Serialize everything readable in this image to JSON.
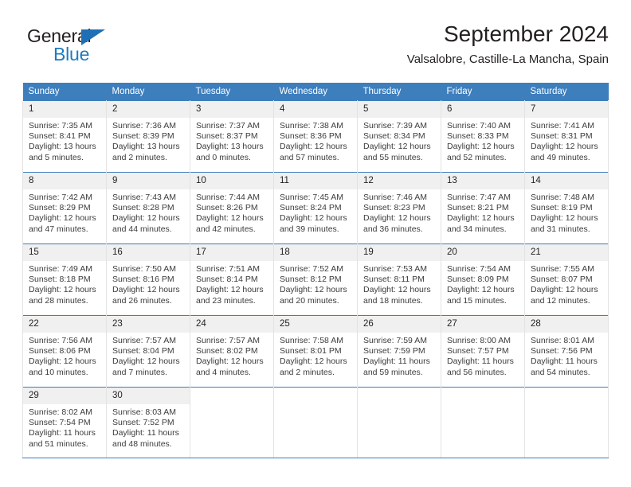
{
  "brand": {
    "name_part1": "General",
    "name_part2": "Blue",
    "triangle_color": "#1f6fb6",
    "blue_color": "#1f7ac0"
  },
  "header": {
    "title": "September 2024",
    "subtitle": "Valsalobre, Castille-La Mancha, Spain"
  },
  "colors": {
    "header_band": "#3d7ebd",
    "daynum_band": "#f0f0f0",
    "cell_border": "#e3e3e3",
    "text": "#231f20"
  },
  "weekdays": [
    "Sunday",
    "Monday",
    "Tuesday",
    "Wednesday",
    "Thursday",
    "Friday",
    "Saturday"
  ],
  "weeks": [
    [
      {
        "day": "1",
        "sunrise": "Sunrise: 7:35 AM",
        "sunset": "Sunset: 8:41 PM",
        "daylight": "Daylight: 13 hours and 5 minutes."
      },
      {
        "day": "2",
        "sunrise": "Sunrise: 7:36 AM",
        "sunset": "Sunset: 8:39 PM",
        "daylight": "Daylight: 13 hours and 2 minutes."
      },
      {
        "day": "3",
        "sunrise": "Sunrise: 7:37 AM",
        "sunset": "Sunset: 8:37 PM",
        "daylight": "Daylight: 13 hours and 0 minutes."
      },
      {
        "day": "4",
        "sunrise": "Sunrise: 7:38 AM",
        "sunset": "Sunset: 8:36 PM",
        "daylight": "Daylight: 12 hours and 57 minutes."
      },
      {
        "day": "5",
        "sunrise": "Sunrise: 7:39 AM",
        "sunset": "Sunset: 8:34 PM",
        "daylight": "Daylight: 12 hours and 55 minutes."
      },
      {
        "day": "6",
        "sunrise": "Sunrise: 7:40 AM",
        "sunset": "Sunset: 8:33 PM",
        "daylight": "Daylight: 12 hours and 52 minutes."
      },
      {
        "day": "7",
        "sunrise": "Sunrise: 7:41 AM",
        "sunset": "Sunset: 8:31 PM",
        "daylight": "Daylight: 12 hours and 49 minutes."
      }
    ],
    [
      {
        "day": "8",
        "sunrise": "Sunrise: 7:42 AM",
        "sunset": "Sunset: 8:29 PM",
        "daylight": "Daylight: 12 hours and 47 minutes."
      },
      {
        "day": "9",
        "sunrise": "Sunrise: 7:43 AM",
        "sunset": "Sunset: 8:28 PM",
        "daylight": "Daylight: 12 hours and 44 minutes."
      },
      {
        "day": "10",
        "sunrise": "Sunrise: 7:44 AM",
        "sunset": "Sunset: 8:26 PM",
        "daylight": "Daylight: 12 hours and 42 minutes."
      },
      {
        "day": "11",
        "sunrise": "Sunrise: 7:45 AM",
        "sunset": "Sunset: 8:24 PM",
        "daylight": "Daylight: 12 hours and 39 minutes."
      },
      {
        "day": "12",
        "sunrise": "Sunrise: 7:46 AM",
        "sunset": "Sunset: 8:23 PM",
        "daylight": "Daylight: 12 hours and 36 minutes."
      },
      {
        "day": "13",
        "sunrise": "Sunrise: 7:47 AM",
        "sunset": "Sunset: 8:21 PM",
        "daylight": "Daylight: 12 hours and 34 minutes."
      },
      {
        "day": "14",
        "sunrise": "Sunrise: 7:48 AM",
        "sunset": "Sunset: 8:19 PM",
        "daylight": "Daylight: 12 hours and 31 minutes."
      }
    ],
    [
      {
        "day": "15",
        "sunrise": "Sunrise: 7:49 AM",
        "sunset": "Sunset: 8:18 PM",
        "daylight": "Daylight: 12 hours and 28 minutes."
      },
      {
        "day": "16",
        "sunrise": "Sunrise: 7:50 AM",
        "sunset": "Sunset: 8:16 PM",
        "daylight": "Daylight: 12 hours and 26 minutes."
      },
      {
        "day": "17",
        "sunrise": "Sunrise: 7:51 AM",
        "sunset": "Sunset: 8:14 PM",
        "daylight": "Daylight: 12 hours and 23 minutes."
      },
      {
        "day": "18",
        "sunrise": "Sunrise: 7:52 AM",
        "sunset": "Sunset: 8:12 PM",
        "daylight": "Daylight: 12 hours and 20 minutes."
      },
      {
        "day": "19",
        "sunrise": "Sunrise: 7:53 AM",
        "sunset": "Sunset: 8:11 PM",
        "daylight": "Daylight: 12 hours and 18 minutes."
      },
      {
        "day": "20",
        "sunrise": "Sunrise: 7:54 AM",
        "sunset": "Sunset: 8:09 PM",
        "daylight": "Daylight: 12 hours and 15 minutes."
      },
      {
        "day": "21",
        "sunrise": "Sunrise: 7:55 AM",
        "sunset": "Sunset: 8:07 PM",
        "daylight": "Daylight: 12 hours and 12 minutes."
      }
    ],
    [
      {
        "day": "22",
        "sunrise": "Sunrise: 7:56 AM",
        "sunset": "Sunset: 8:06 PM",
        "daylight": "Daylight: 12 hours and 10 minutes."
      },
      {
        "day": "23",
        "sunrise": "Sunrise: 7:57 AM",
        "sunset": "Sunset: 8:04 PM",
        "daylight": "Daylight: 12 hours and 7 minutes."
      },
      {
        "day": "24",
        "sunrise": "Sunrise: 7:57 AM",
        "sunset": "Sunset: 8:02 PM",
        "daylight": "Daylight: 12 hours and 4 minutes."
      },
      {
        "day": "25",
        "sunrise": "Sunrise: 7:58 AM",
        "sunset": "Sunset: 8:01 PM",
        "daylight": "Daylight: 12 hours and 2 minutes."
      },
      {
        "day": "26",
        "sunrise": "Sunrise: 7:59 AM",
        "sunset": "Sunset: 7:59 PM",
        "daylight": "Daylight: 11 hours and 59 minutes."
      },
      {
        "day": "27",
        "sunrise": "Sunrise: 8:00 AM",
        "sunset": "Sunset: 7:57 PM",
        "daylight": "Daylight: 11 hours and 56 minutes."
      },
      {
        "day": "28",
        "sunrise": "Sunrise: 8:01 AM",
        "sunset": "Sunset: 7:56 PM",
        "daylight": "Daylight: 11 hours and 54 minutes."
      }
    ],
    [
      {
        "day": "29",
        "sunrise": "Sunrise: 8:02 AM",
        "sunset": "Sunset: 7:54 PM",
        "daylight": "Daylight: 11 hours and 51 minutes."
      },
      {
        "day": "30",
        "sunrise": "Sunrise: 8:03 AM",
        "sunset": "Sunset: 7:52 PM",
        "daylight": "Daylight: 11 hours and 48 minutes."
      },
      {
        "day": "",
        "sunrise": "",
        "sunset": "",
        "daylight": ""
      },
      {
        "day": "",
        "sunrise": "",
        "sunset": "",
        "daylight": ""
      },
      {
        "day": "",
        "sunrise": "",
        "sunset": "",
        "daylight": ""
      },
      {
        "day": "",
        "sunrise": "",
        "sunset": "",
        "daylight": ""
      },
      {
        "day": "",
        "sunrise": "",
        "sunset": "",
        "daylight": ""
      }
    ]
  ]
}
